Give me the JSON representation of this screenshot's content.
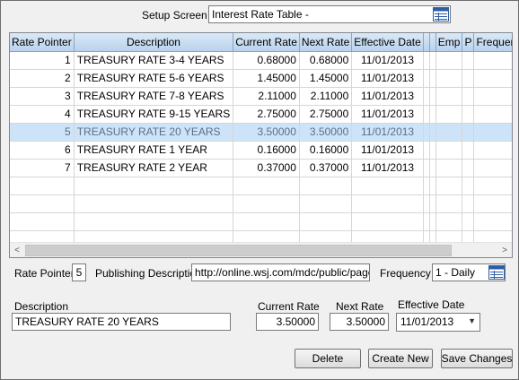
{
  "setup": {
    "label": "Setup Screen",
    "value": "Interest Rate Table -",
    "icon": "table-icon"
  },
  "grid": {
    "columns": [
      "Rate Pointer",
      "Description",
      "Current Rate",
      "Next Rate",
      "Effective Date",
      "",
      "",
      "Emp",
      "P",
      "Frequer"
    ],
    "rows": [
      {
        "pointer": "1",
        "description": "TREASURY RATE 3-4 YEARS",
        "current": "0.68000",
        "next": "0.68000",
        "date": "11/01/2013"
      },
      {
        "pointer": "2",
        "description": "TREASURY RATE 5-6 YEARS",
        "current": "1.45000",
        "next": "1.45000",
        "date": "11/01/2013"
      },
      {
        "pointer": "3",
        "description": "TREASURY RATE 7-8 YEARS",
        "current": "2.11000",
        "next": "2.11000",
        "date": "11/01/2013"
      },
      {
        "pointer": "4",
        "description": "TREASURY RATE 9-15 YEARS",
        "current": "2.75000",
        "next": "2.75000",
        "date": "11/01/2013"
      },
      {
        "pointer": "5",
        "description": "TREASURY RATE 20 YEARS",
        "current": "3.50000",
        "next": "3.50000",
        "date": "11/01/2013"
      },
      {
        "pointer": "6",
        "description": "TREASURY RATE 1 YEAR",
        "current": "0.16000",
        "next": "0.16000",
        "date": "11/01/2013"
      },
      {
        "pointer": "7",
        "description": "TREASURY RATE 2 YEAR",
        "current": "0.37000",
        "next": "0.37000",
        "date": "11/01/2013"
      }
    ],
    "selected_row": 4,
    "scroll_left": "<",
    "scroll_right": ">"
  },
  "detail": {
    "rate_pointer_label": "Rate Pointer",
    "rate_pointer_value": "5",
    "publishing_label": "Publishing Description",
    "publishing_value": "http://online.wsj.com/mdc/public/page/",
    "frequency_label": "Frequency",
    "frequency_value": "1 - Daily",
    "description_label": "Description",
    "description_value": "TREASURY RATE 20 YEARS",
    "current_rate_label": "Current Rate",
    "current_rate_value": "3.50000",
    "next_rate_label": "Next Rate",
    "next_rate_value": "3.50000",
    "effective_date_label": "Effective Date",
    "effective_date_value": "11/01/2013"
  },
  "buttons": {
    "delete": "Delete",
    "create_new": "Create New",
    "save_changes": "Save Changes"
  }
}
